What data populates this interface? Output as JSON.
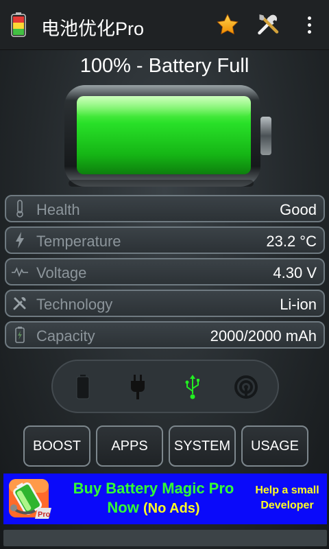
{
  "app": {
    "title": "电池优化Pro"
  },
  "status": {
    "title": "100% - Battery Full",
    "level_percent": 100
  },
  "info_rows": [
    {
      "icon": "thermometer-icon",
      "label": "Health",
      "value": "Good"
    },
    {
      "icon": "bolt-icon",
      "label": "Temperature",
      "value": "23.2 °C"
    },
    {
      "icon": "pulse-icon",
      "label": "Voltage",
      "value": "4.30 V"
    },
    {
      "icon": "tools-icon",
      "label": "Technology",
      "value": "Li-ion"
    },
    {
      "icon": "battery-small-icon",
      "label": "Capacity",
      "value": "2000/2000 mAh"
    }
  ],
  "charge_modes": [
    {
      "name": "battery",
      "active": false
    },
    {
      "name": "ac-plug",
      "active": false
    },
    {
      "name": "usb",
      "active": true
    },
    {
      "name": "wireless",
      "active": false
    }
  ],
  "nav": {
    "boost": "BOOST",
    "apps": "APPS",
    "system": "SYSTEM",
    "usage": "USAGE"
  },
  "ad": {
    "line1": "Buy Battery Magic Pro",
    "line2_a": "Now",
    "line2_b": "(No Ads)",
    "side_line1": "Help a small",
    "side_line2": "Developer",
    "icon_badge": "Pro"
  },
  "colors": {
    "accent_green": "#22ee22",
    "ad_blue": "#0a0afa",
    "ad_yellow": "#ffff22"
  }
}
